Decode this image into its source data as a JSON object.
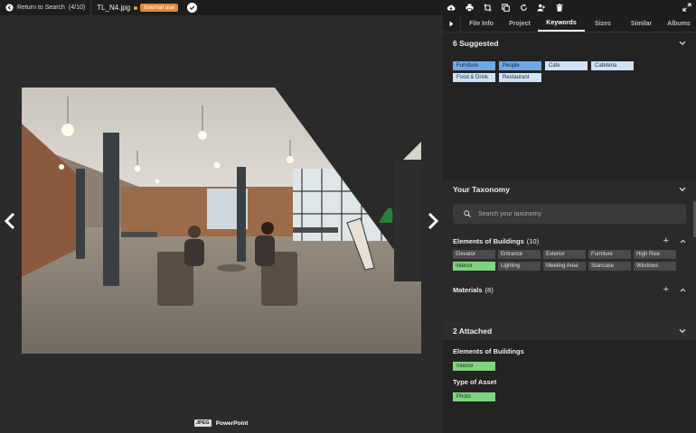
{
  "topbar": {
    "back_label": "Return to Search",
    "back_count": "(4/10)",
    "filename": "TL_N4.jpg",
    "badge": "Internal use",
    "tools": [
      "download-icon",
      "print-icon",
      "crop-icon",
      "duplicate-icon",
      "rotate-icon",
      "share-user-icon",
      "delete-icon"
    ]
  },
  "viewer": {
    "formats": {
      "jpeg": "JPEG",
      "ppt": "PowerPoint"
    }
  },
  "tabs": [
    "File Info",
    "Project",
    "Keywords",
    "Sizes",
    "Similar",
    "Albums"
  ],
  "active_tab": "Keywords",
  "suggested": {
    "title": "6 Suggested",
    "keywords": [
      {
        "label": "Furniture",
        "style": "blue"
      },
      {
        "label": "People",
        "style": "blue"
      },
      {
        "label": "Cafe",
        "style": "light"
      },
      {
        "label": "Cafeteria",
        "style": "light"
      },
      {
        "label": "Food & Drink",
        "style": "light"
      },
      {
        "label": "Restaurant",
        "style": "light"
      }
    ]
  },
  "taxonomy": {
    "title": "Your Taxonomy",
    "search_placeholder": "Search your taxonomy",
    "groups": [
      {
        "name": "Elements of Buildings",
        "count": "(10)",
        "items": [
          {
            "label": "Elevator",
            "selected": false
          },
          {
            "label": "Entrance",
            "selected": false
          },
          {
            "label": "Exterior",
            "selected": false
          },
          {
            "label": "Furniture",
            "selected": false
          },
          {
            "label": "High Rise",
            "selected": false
          },
          {
            "label": "Interior",
            "selected": true
          },
          {
            "label": "Lighting",
            "selected": false
          },
          {
            "label": "Meeting Area",
            "selected": false
          },
          {
            "label": "Staircase",
            "selected": false
          },
          {
            "label": "Windows",
            "selected": false
          }
        ]
      },
      {
        "name": "Materials",
        "count": "(8)"
      }
    ]
  },
  "attached": {
    "title": "2 Attached",
    "groups": [
      {
        "name": "Elements of Buildings",
        "value": "Interior"
      },
      {
        "name": "Type of Asset",
        "value": "Photo"
      }
    ]
  },
  "colors": {
    "accent_orange": "#e08a3a",
    "chip_blue": "#6fa8e8",
    "chip_light": "#cfe2f6",
    "chip_green": "#7fd47f"
  }
}
